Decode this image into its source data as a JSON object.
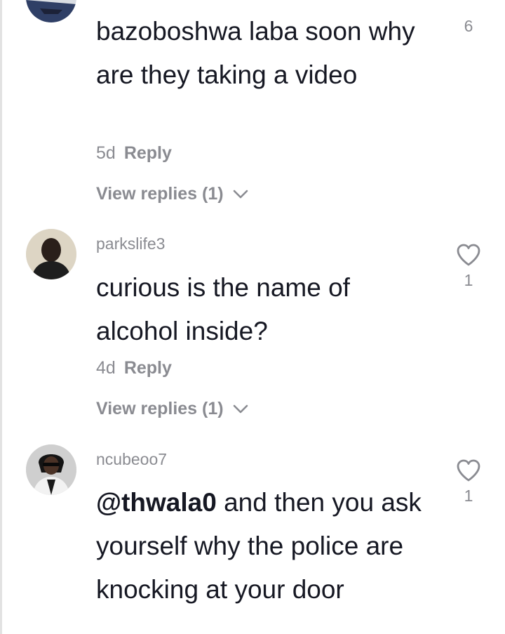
{
  "comments": [
    {
      "username": "",
      "text": "bazoboshwa laba soon why are they taking a video",
      "time": "5d",
      "reply_label": "Reply",
      "view_replies": "View replies (1)",
      "likes": "6"
    },
    {
      "username": "parkslife3",
      "text": "curious is the name of alcohol inside?",
      "time": "4d",
      "reply_label": "Reply",
      "view_replies": "View replies (1)",
      "likes": "1"
    },
    {
      "username": "ncubeoo7",
      "mention": "@thwala0",
      "text": " and then you ask yourself why the police are knocking at your door",
      "likes": "1"
    }
  ],
  "icons": {
    "like": "heart-outline-icon",
    "expand": "chevron-down-icon"
  },
  "colors": {
    "text": "#161823",
    "secondary": "#8a8b91",
    "background": "#ffffff"
  }
}
